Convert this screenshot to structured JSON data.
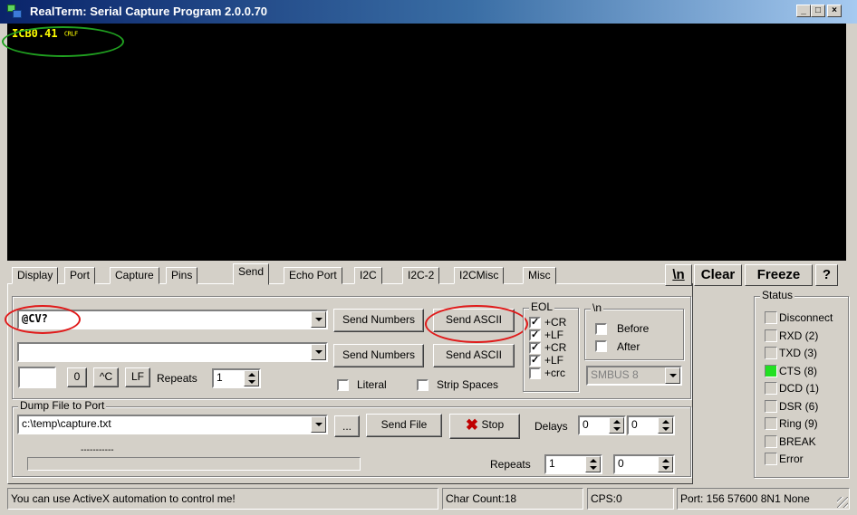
{
  "window": {
    "title": "RealTerm: Serial Capture Program 2.0.0.70",
    "buttons": {
      "minimize": "_",
      "maximize": "□",
      "close": "×"
    }
  },
  "terminal": {
    "text": "ICB0.41",
    "line_end": "CRLF"
  },
  "tabs": [
    "Display",
    "Port",
    "Capture",
    "Pins",
    "Send",
    "Echo Port",
    "I2C",
    "I2C-2",
    "I2CMisc",
    "Misc"
  ],
  "active_tab": "Send",
  "toolbar": {
    "newline_label": "\\n",
    "clear_label": "Clear",
    "freeze_label": "Freeze",
    "help_label": "?"
  },
  "send": {
    "row1_value": "@CV?",
    "row2_value": "",
    "send_numbers": "Send Numbers",
    "send_ascii": "Send ASCII",
    "send_numbers_2": "Send Numbers",
    "send_ascii_2": "Send ASCII",
    "small_value": "",
    "zero_btn": "0",
    "ctrl_c_btn": "^C",
    "lf_btn": "LF",
    "repeats_label": "Repeats",
    "repeats_value": "1",
    "literal_label": "Literal",
    "strip_spaces_label": "Strip Spaces"
  },
  "eol": {
    "title": "EOL",
    "items": [
      {
        "label": "+CR",
        "checked": true
      },
      {
        "label": "+LF",
        "checked": true
      },
      {
        "label": "+CR",
        "checked": true
      },
      {
        "label": "+LF",
        "checked": true
      },
      {
        "label": "+crc",
        "checked": false
      }
    ]
  },
  "newline_group": {
    "title": "\\n",
    "before_label": "Before",
    "after_label": "After",
    "smbus_value": "SMBUS 8"
  },
  "dump": {
    "title": "Dump File to Port",
    "path": "c:\\temp\\capture.txt",
    "browse_label": "...",
    "send_file_label": "Send File",
    "stop_label": "Stop",
    "delays_label": "Delays",
    "delay1": "0",
    "delay2": "0",
    "repeats_label": "Repeats",
    "repeats1": "1",
    "repeats2": "0",
    "progress_text": "-----------"
  },
  "status": {
    "title": "Status",
    "items": [
      {
        "label": "Disconnect",
        "on": false
      },
      {
        "label": "RXD (2)",
        "on": false
      },
      {
        "label": "TXD (3)",
        "on": false
      },
      {
        "label": "CTS (8)",
        "on": true
      },
      {
        "label": "DCD (1)",
        "on": false
      },
      {
        "label": "DSR (6)",
        "on": false
      },
      {
        "label": "Ring (9)",
        "on": false
      },
      {
        "label": "BREAK",
        "on": false
      },
      {
        "label": "Error",
        "on": false
      }
    ],
    "led_on_color": "#22e022"
  },
  "statusbar": {
    "message": "You can use ActiveX automation to control me!",
    "char_count": "Char Count:18",
    "cps": "CPS:0",
    "port": "Port: 156 57600 8N1 None"
  },
  "colors": {
    "terminal_bg": "#000000",
    "terminal_text": "#ffff00",
    "highlight_green": "#20a020",
    "highlight_red": "#e01a1a"
  }
}
